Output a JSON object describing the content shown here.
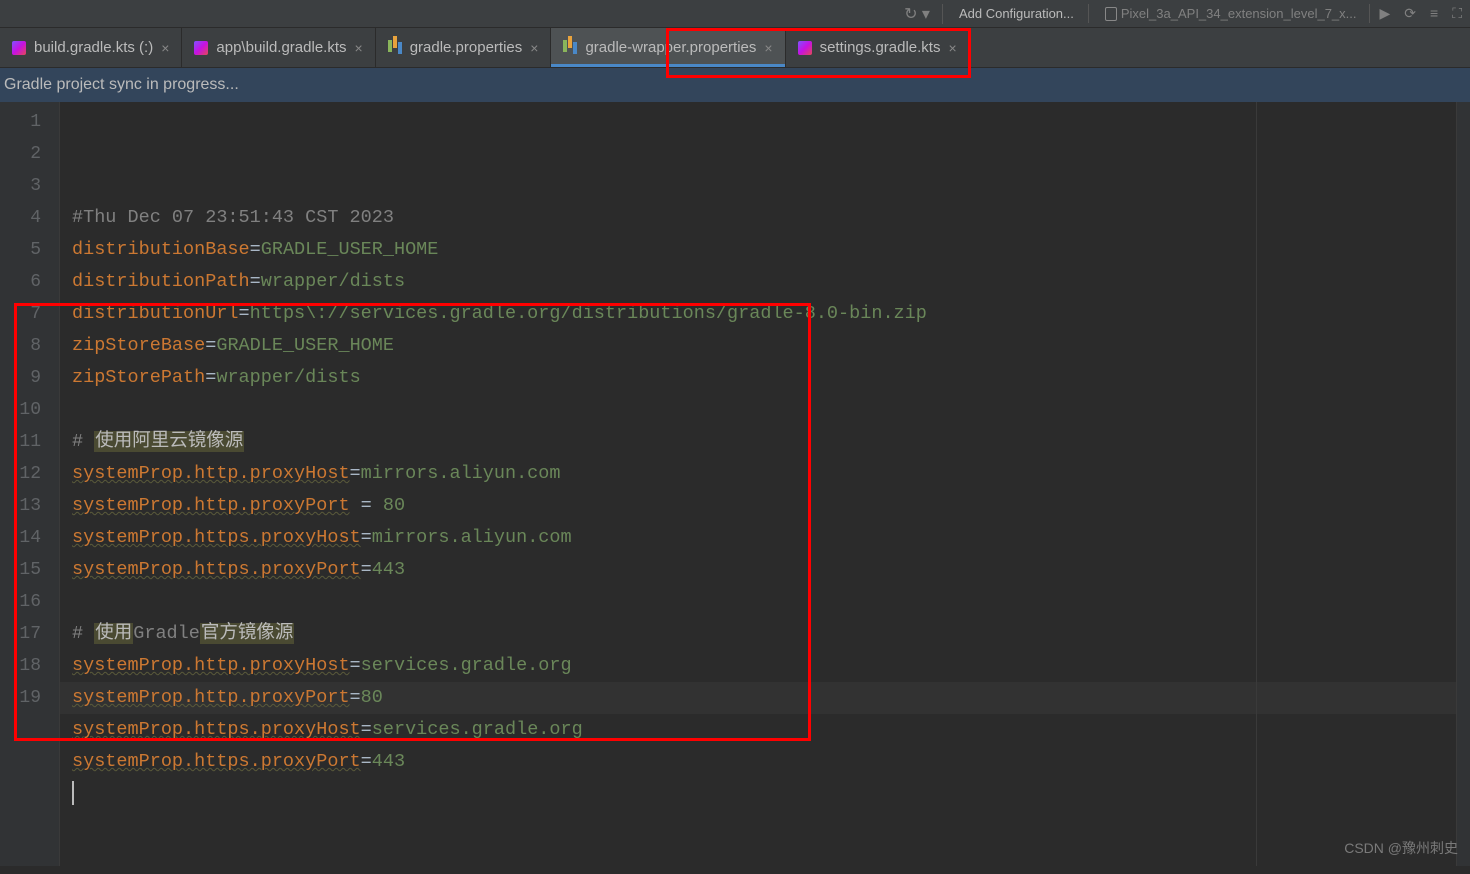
{
  "toolbar": {
    "config_label": "Add Configuration...",
    "device_label": "Pixel_3a_API_34_extension_level_7_x..."
  },
  "tabs": [
    {
      "label": "build.gradle.kts (:)",
      "type": "kts",
      "active": false
    },
    {
      "label": "app\\build.gradle.kts",
      "type": "kts",
      "active": false
    },
    {
      "label": "gradle.properties",
      "type": "props",
      "active": false
    },
    {
      "label": "gradle-wrapper.properties",
      "type": "props",
      "active": true
    },
    {
      "label": "settings.gradle.kts",
      "type": "kts",
      "active": false
    }
  ],
  "sync_message": "Gradle project sync in progress...",
  "gutter_start": 1,
  "gutter_end": 19,
  "code": {
    "lines": [
      {
        "t": "comment",
        "text": "#Thu Dec 07 23:51:43 CST 2023"
      },
      {
        "t": "kv",
        "key": "distributionBase",
        "eq": "=",
        "val": "GRADLE_USER_HOME"
      },
      {
        "t": "kv",
        "key": "distributionPath",
        "eq": "=",
        "val": "wrapper/dists"
      },
      {
        "t": "kv",
        "key": "distributionUrl",
        "eq": "=",
        "val": "https\\://services.gradle.org/distributions/gradle-8.0-bin.zip"
      },
      {
        "t": "kv",
        "key": "zipStoreBase",
        "eq": "=",
        "val": "GRADLE_USER_HOME"
      },
      {
        "t": "kv",
        "key": "zipStorePath",
        "eq": "=",
        "val": "wrapper/dists"
      },
      {
        "t": "blank"
      },
      {
        "t": "comment-hl",
        "prefix": "# ",
        "hl": "使用阿里云镜像源"
      },
      {
        "t": "kvw",
        "key": "systemProp.http.proxyHost",
        "eq": "=",
        "val": "mirrors.aliyun.com"
      },
      {
        "t": "kvw",
        "key": "systemProp.http.proxyPort",
        "eq": " = ",
        "val": "80"
      },
      {
        "t": "kvw",
        "key": "systemProp.https.proxyHost",
        "eq": "=",
        "val": "mirrors.aliyun.com"
      },
      {
        "t": "kvw",
        "key": "systemProp.https.proxyPort",
        "eq": "=",
        "val": "443"
      },
      {
        "t": "blank"
      },
      {
        "t": "comment-hl2",
        "prefix": "# ",
        "hl1": "使用",
        "mid": "Gradle",
        "hl2": "官方镜像源"
      },
      {
        "t": "kvw",
        "key": "systemProp.http.proxyHost",
        "eq": "=",
        "val": "services.gradle.org"
      },
      {
        "t": "kvw",
        "key": "systemProp.http.proxyPort",
        "eq": "=",
        "val": "80"
      },
      {
        "t": "kvw",
        "key": "systemProp.https.proxyHost",
        "eq": "=",
        "val": "services.gradle.org"
      },
      {
        "t": "kvw",
        "key": "systemProp.https.proxyPort",
        "eq": "=",
        "val": "443"
      },
      {
        "t": "caret"
      }
    ]
  },
  "watermark": "CSDN @豫州刺史"
}
